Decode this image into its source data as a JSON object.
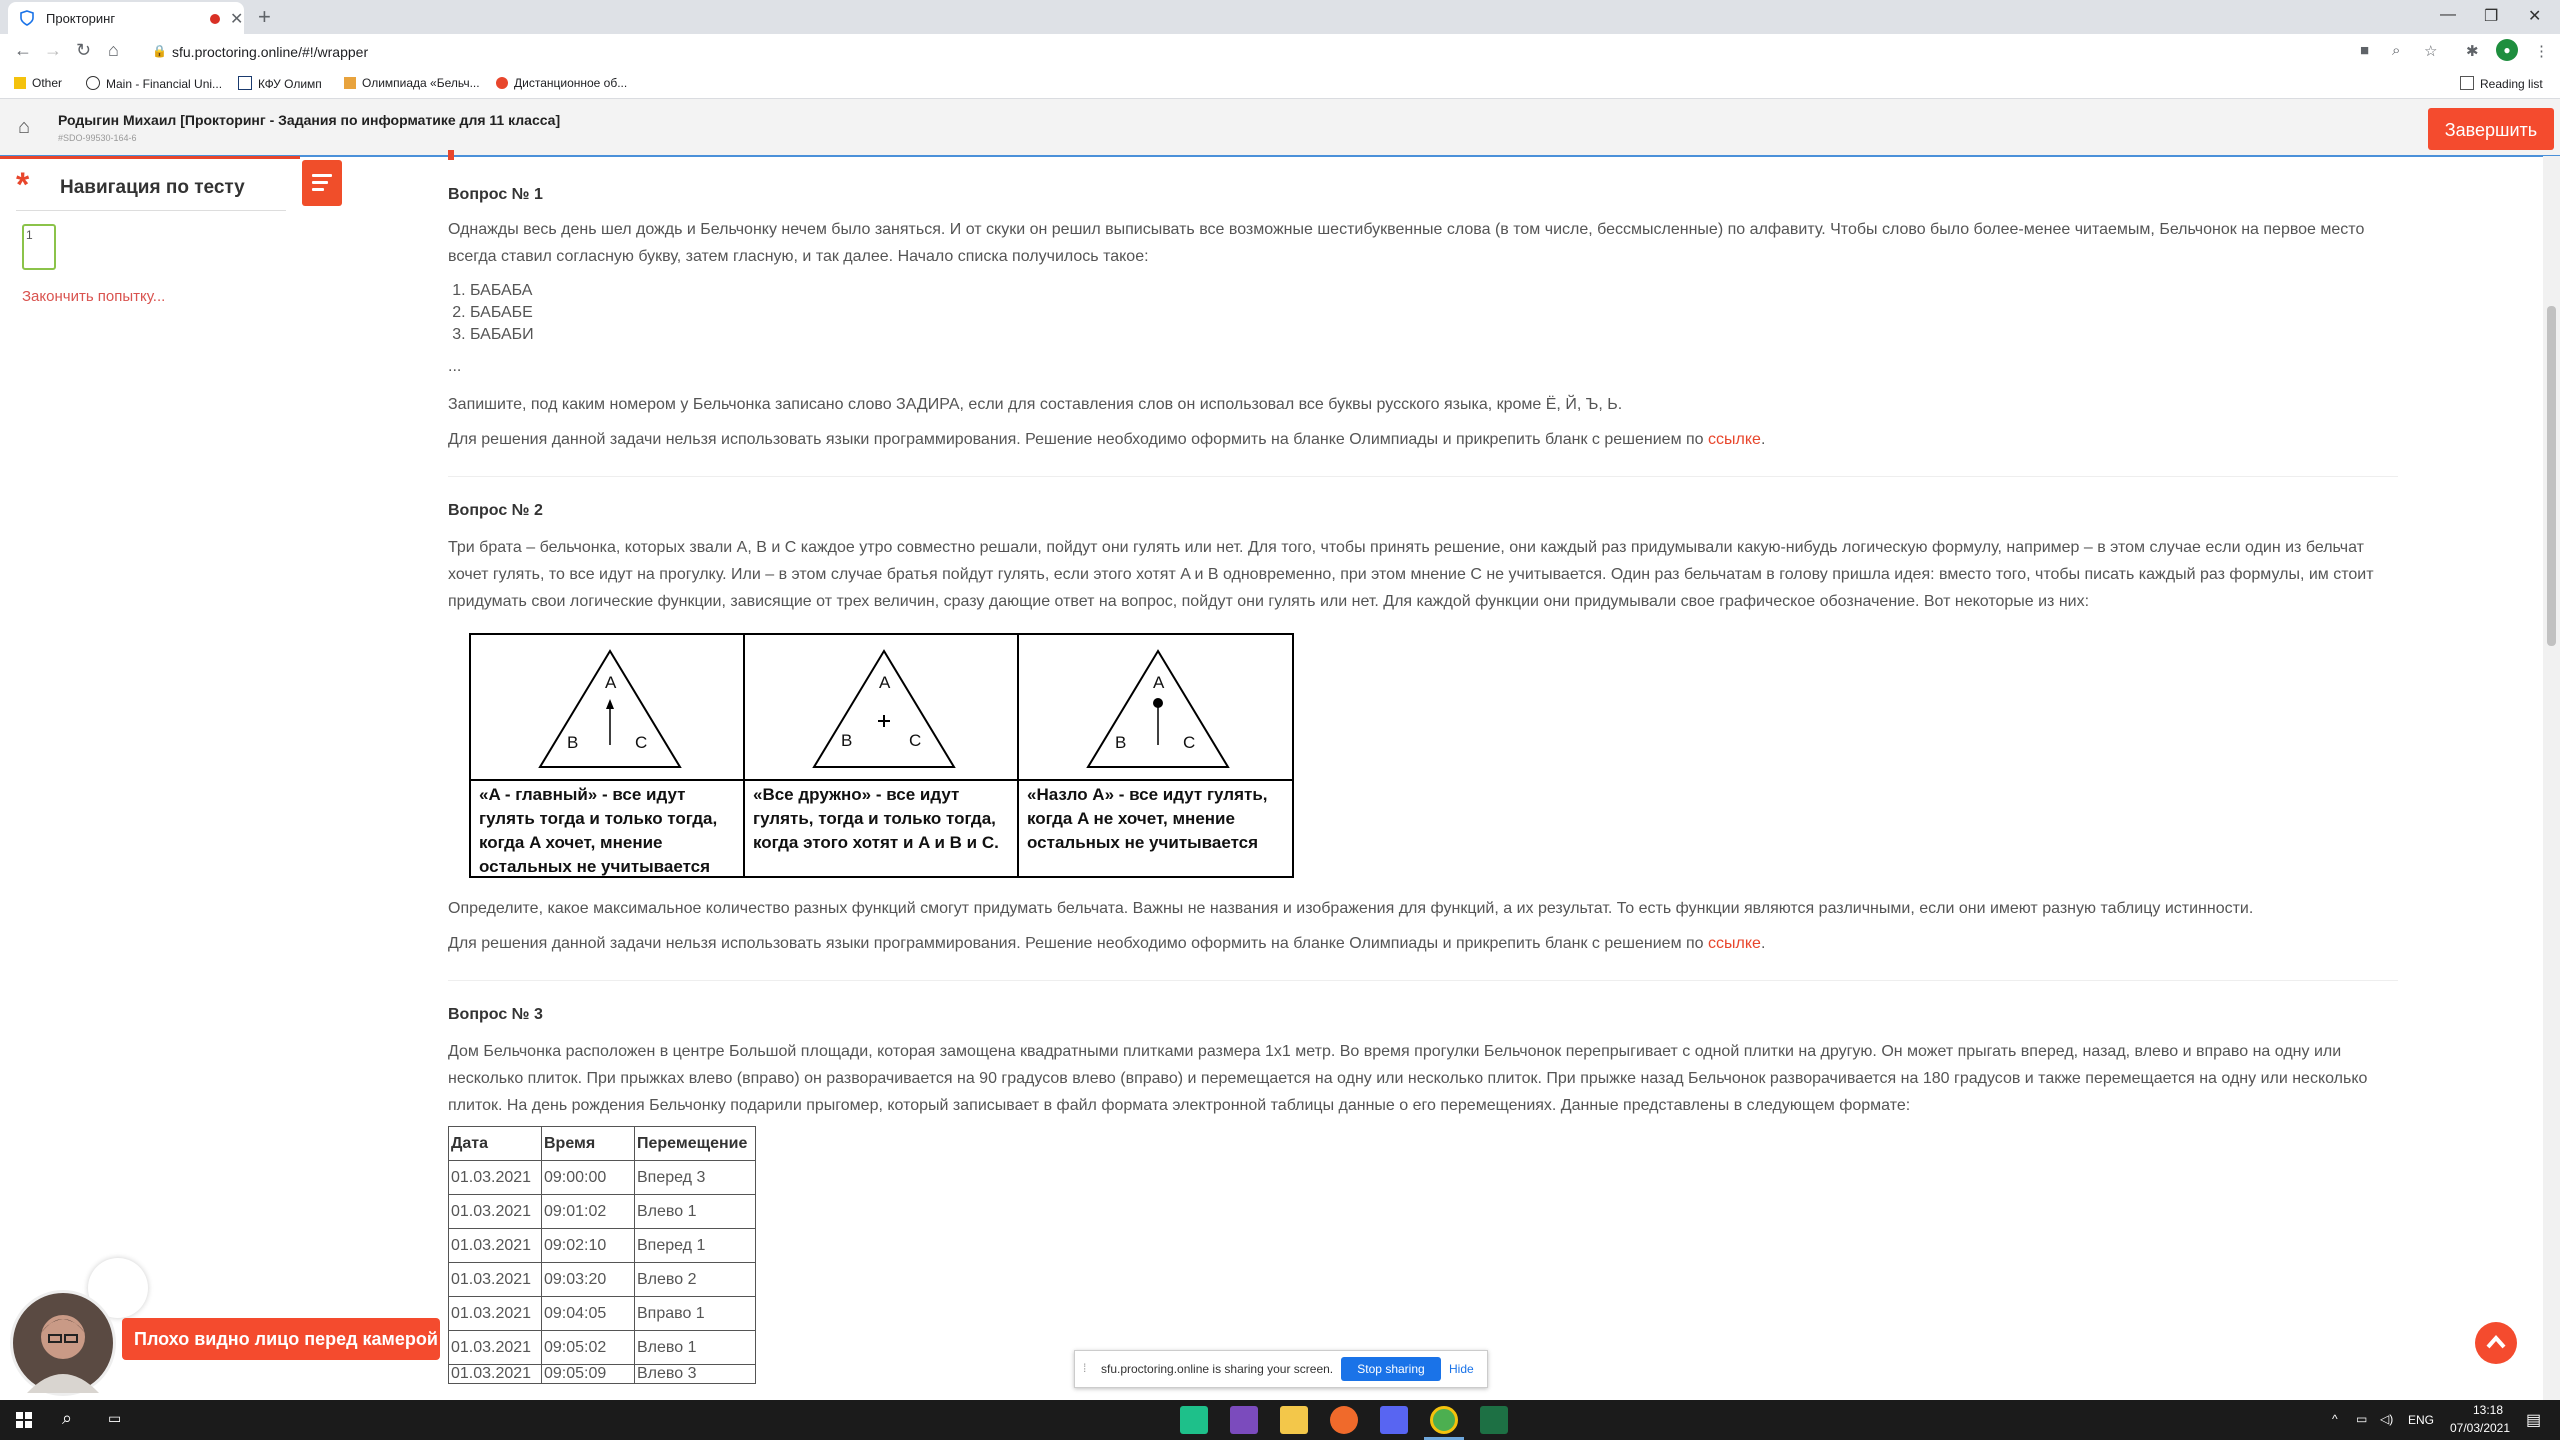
{
  "browser": {
    "tab_title": "Прокторинг",
    "url": "sfu.proctoring.online/#!/wrapper",
    "bookmarks": [
      "Other",
      "Main - Financial Uni...",
      "КФУ Олимп",
      "Олимпиада «Бельч...",
      "Дистанционное об..."
    ],
    "reading_list": "Reading list"
  },
  "header": {
    "title": "Родыгин Михаил [Прокторинг - Задания по информатике для 11 класса]",
    "subtitle": "#SDO-99530-164-6",
    "finish_label": "Завершить"
  },
  "nav": {
    "title": "Навигация по тесту",
    "question_number": "1",
    "finish_attempt": "Закончить попытку..."
  },
  "q1": {
    "title": "Вопрос № 1",
    "text": "Однажды весь день шел дождь и Бельчонку нечем было заняться. И от скуки он решил выписывать все возможные шестибуквенные слова (в том числе, бессмысленные) по алфавиту. Чтобы слово было более-менее читаемым, Бельчонок на первое место всегда ставил согласную букву, затем гласную, и так далее. Начало списка получилось такое:",
    "list": [
      "БАБАБА",
      "БАБАБЕ",
      "БАБАБИ"
    ],
    "ellipsis": "...",
    "task": "Запишите, под каким номером у Бельчонка записано слово ЗАДИРА, если для составления слов он использовал все буквы русского языка, кроме Ё, Й, Ъ, Ь.",
    "note": "Для решения данной задачи нельзя использовать языки программирования. Решение необходимо оформить на бланке Олимпиады и прикрепить бланк с решением по",
    "link": "ссылке",
    "period": "."
  },
  "q2": {
    "title": "Вопрос № 2",
    "text": "Три брата – бельчонка, которых звали A, B и C каждое утро совместно решали, пойдут они гулять или нет. Для того, чтобы принять решение, они каждый раз придумывали какую-нибудь логическую формулу, например  – в этом случае если один из бельчат хочет гулять, то все идут на прогулку. Или  – в этом случае братья пойдут гулять, если этого хотят A и B одновременно, при этом мнение C не учитывается. Один раз бельчатам в голову пришла идея: вместо того, чтобы писать каждый раз формулы, им стоит придумать свои логические функции, зависящие от трех величин, сразу дающие ответ на вопрос, пойдут они гулять или нет. Для каждой функции они придумывали свое графическое обозначение. Вот некоторые из них:",
    "figures": [
      {
        "top": "A",
        "left": "B",
        "right": "C",
        "mark": "arrow",
        "caption": "«A - главный» - все идут гулять тогда и только тогда, когда A хочет, мнение остальных не учитывается"
      },
      {
        "top": "A",
        "left": "B",
        "right": "C",
        "mark": "plus",
        "caption": "«Все дружно» - все идут гулять, тогда и только тогда, когда этого хотят и A и B и C."
      },
      {
        "top": "A",
        "left": "B",
        "right": "C",
        "mark": "dot",
        "caption": "«Назло A» - все идут гулять, когда A не хочет, мнение остальных не учитывается"
      }
    ],
    "task": "Определите, какое максимальное количество разных функций смогут придумать бельчата. Важны не названия и изображения для функций, а их результат. То есть функции являются различными, если они имеют разную таблицу истинности.",
    "note": "Для решения данной задачи нельзя использовать языки программирования. Решение необходимо оформить на бланке Олимпиады и прикрепить бланк с решением по",
    "link": "ссылке",
    "period": "."
  },
  "q3": {
    "title": "Вопрос № 3",
    "text": "Дом Бельчонка расположен в центре Большой площади, которая замощена квадратными плитками размера 1х1 метр. Во время прогулки Бельчонок перепрыгивает с одной плитки на другую. Он может прыгать вперед, назад, влево и вправо на одну или несколько плиток. При прыжках влево (вправо) он разворачивается на 90 градусов влево (вправо) и перемещается на одну или несколько плиток. При прыжке назад Бельчонок разворачивается на 180 градусов и также перемещается на одну или несколько плиток. На день рождения Бельчонку подарили прыгомер, который записывает в файл формата электронной таблицы данные о его перемещениях. Данные представлены в следующем формате:",
    "table": {
      "headers": [
        "Дата",
        "Время",
        "Перемещение"
      ],
      "rows": [
        [
          "01.03.2021",
          "09:00:00",
          "Вперед 3"
        ],
        [
          "01.03.2021",
          "09:01:02",
          "Влево 1"
        ],
        [
          "01.03.2021",
          "09:02:10",
          "Вперед 1"
        ],
        [
          "01.03.2021",
          "09:03:20",
          "Влево 2"
        ],
        [
          "01.03.2021",
          "09:04:05",
          "Вправо 1"
        ],
        [
          "01.03.2021",
          "09:05:02",
          "Влево 1"
        ],
        [
          "01.03.2021",
          "09:05:09",
          "Влево 3"
        ]
      ]
    }
  },
  "overlay": {
    "camera_warning": "Плохо видно лицо перед камерой",
    "share_text": "sfu.proctoring.online is sharing your screen.",
    "stop_sharing": "Stop sharing",
    "hide": "Hide"
  },
  "taskbar": {
    "lang": "ENG",
    "time": "13:18",
    "date": "07/03/2021"
  },
  "colors": {
    "accent": "#f44b2e",
    "link": "#e8462c",
    "nav_box": "#8bc34a"
  }
}
